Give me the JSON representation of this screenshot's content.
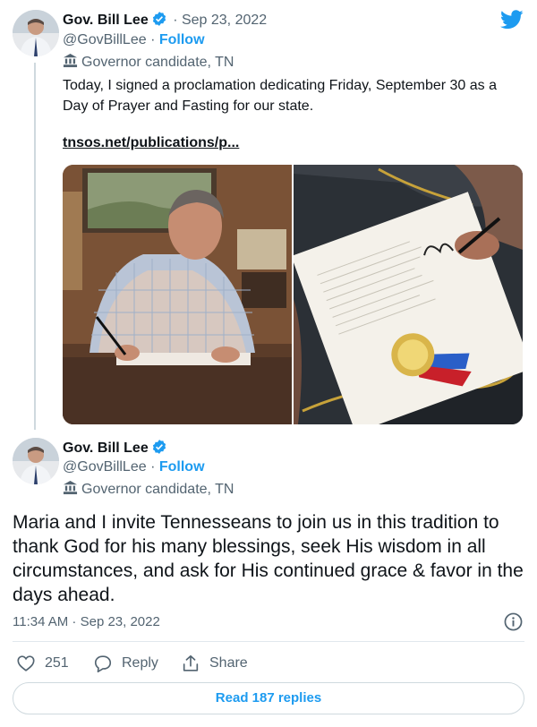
{
  "tweet1": {
    "name": "Gov. Bill Lee",
    "date": "· Sep 23, 2022",
    "handle": "@GovBillLee",
    "dot": "·",
    "follow": "Follow",
    "label": "Governor candidate, TN",
    "text": "Today, I signed a proclamation dedicating Friday, September 30 as a Day of Prayer and Fasting for our state.",
    "link": "tnsos.net/publications/p..."
  },
  "tweet2": {
    "name": "Gov. Bill Lee",
    "handle": "@GovBillLee",
    "dot": "·",
    "follow": "Follow",
    "label": "Governor candidate, TN",
    "text": "Maria and I invite Tennesseans to join us in this tradition to thank God for his many blessings, seek His wisdom in all circumstances, and ask for His continued grace & favor in the days ahead.",
    "timestamp": "11:34 AM · Sep 23, 2022"
  },
  "actions": {
    "likes": "251",
    "reply": "Reply",
    "share": "Share"
  },
  "read_replies": "Read 187 replies",
  "colors": {
    "accent": "#1d9bf0",
    "text": "#0f1419",
    "muted": "#536471"
  },
  "icons": [
    "twitter-logo-icon",
    "verified-badge-icon",
    "governor-label-icon",
    "heart-icon",
    "reply-icon",
    "share-icon",
    "info-icon"
  ]
}
